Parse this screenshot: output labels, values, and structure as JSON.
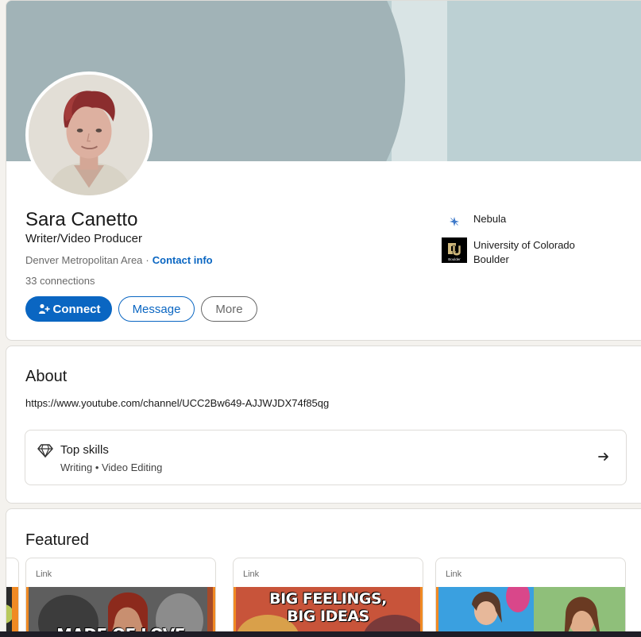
{
  "profile": {
    "name": "Sara Canetto",
    "headline": "Writer/Video Producer",
    "location": "Denver Metropolitan Area",
    "separator": "·",
    "contact_info": "Contact info",
    "connections": "33 connections"
  },
  "actions": {
    "connect": "Connect",
    "message": "Message",
    "more": "More"
  },
  "side": {
    "company": "Nebula",
    "school": "University of Colorado Boulder",
    "school_logo_text": "Boulder"
  },
  "about": {
    "title": "About",
    "text": "https://www.youtube.com/channel/UCC2Bw649-AJJWJDX74f85qg",
    "skills_title": "Top skills",
    "skills": "Writing • Video Editing"
  },
  "featured": {
    "title": "Featured",
    "items": [
      {
        "label": "Link",
        "thumb_text": "MADE OF LOVE"
      },
      {
        "label": "Link",
        "thumb_text_1": "BIG FEELINGS,",
        "thumb_text_2": "BIG IDEAS"
      },
      {
        "label": "Link"
      }
    ]
  },
  "colors": {
    "primary": "#0a66c2",
    "banner_light": "#bcd0d3",
    "banner_dark": "#a1b3b7",
    "cu_gold": "#cfb87c"
  },
  "icons": [
    "user-plus-icon",
    "nebula-logo-icon",
    "cu-boulder-logo-icon",
    "diamond-icon",
    "arrow-right-icon"
  ]
}
